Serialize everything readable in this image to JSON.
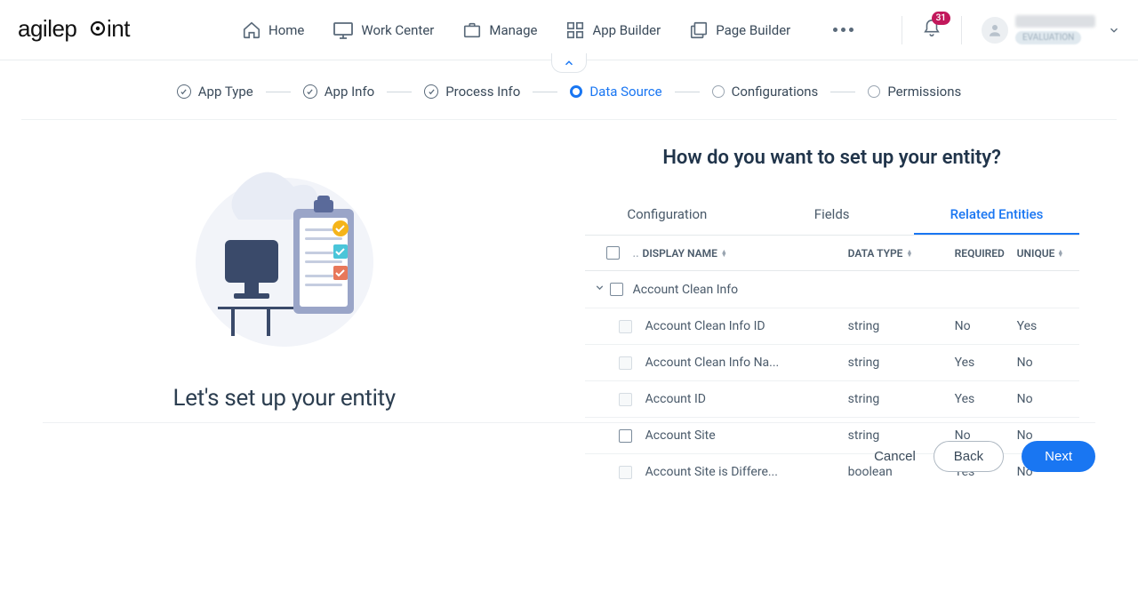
{
  "branding": {
    "logo_text": "agilepoint"
  },
  "nav": {
    "home": "Home",
    "work_center": "Work Center",
    "manage": "Manage",
    "app_builder": "App Builder",
    "page_builder": "Page Builder"
  },
  "notifications": {
    "count": "31"
  },
  "user": {
    "name": "MuraliGowda",
    "tag": "EVALUATION"
  },
  "steps": [
    {
      "label": "App Type",
      "state": "done"
    },
    {
      "label": "App Info",
      "state": "done"
    },
    {
      "label": "Process Info",
      "state": "done"
    },
    {
      "label": "Data Source",
      "state": "active"
    },
    {
      "label": "Configurations",
      "state": "todo"
    },
    {
      "label": "Permissions",
      "state": "todo"
    }
  ],
  "left": {
    "title": "Let's set up your entity"
  },
  "right": {
    "title": "How do you want to set up your entity?",
    "tabs": [
      {
        "label": "Configuration",
        "active": false
      },
      {
        "label": "Fields",
        "active": false
      },
      {
        "label": "Related Entities",
        "active": true
      }
    ],
    "columns": {
      "display_name": "DISPLAY NAME",
      "data_type": "DATA TYPE",
      "required": "REQUIRED",
      "unique": "UNIQUE"
    },
    "group": {
      "label": "Account Clean Info"
    },
    "rows": [
      {
        "name": "Account Clean Info ID",
        "type": "string",
        "required": "No",
        "unique": "Yes",
        "cb_enabled": false
      },
      {
        "name": "Account Clean Info Name",
        "type": "string",
        "required": "Yes",
        "unique": "No",
        "cb_enabled": false
      },
      {
        "name": "Account ID",
        "type": "string",
        "required": "Yes",
        "unique": "No",
        "cb_enabled": false
      },
      {
        "name": "Account Site",
        "type": "string",
        "required": "No",
        "unique": "No",
        "cb_enabled": true
      },
      {
        "name": "Account Site is Different",
        "type": "boolean",
        "required": "Yes",
        "unique": "No",
        "cb_enabled": false
      }
    ]
  },
  "footer": {
    "cancel": "Cancel",
    "back": "Back",
    "next": "Next"
  }
}
